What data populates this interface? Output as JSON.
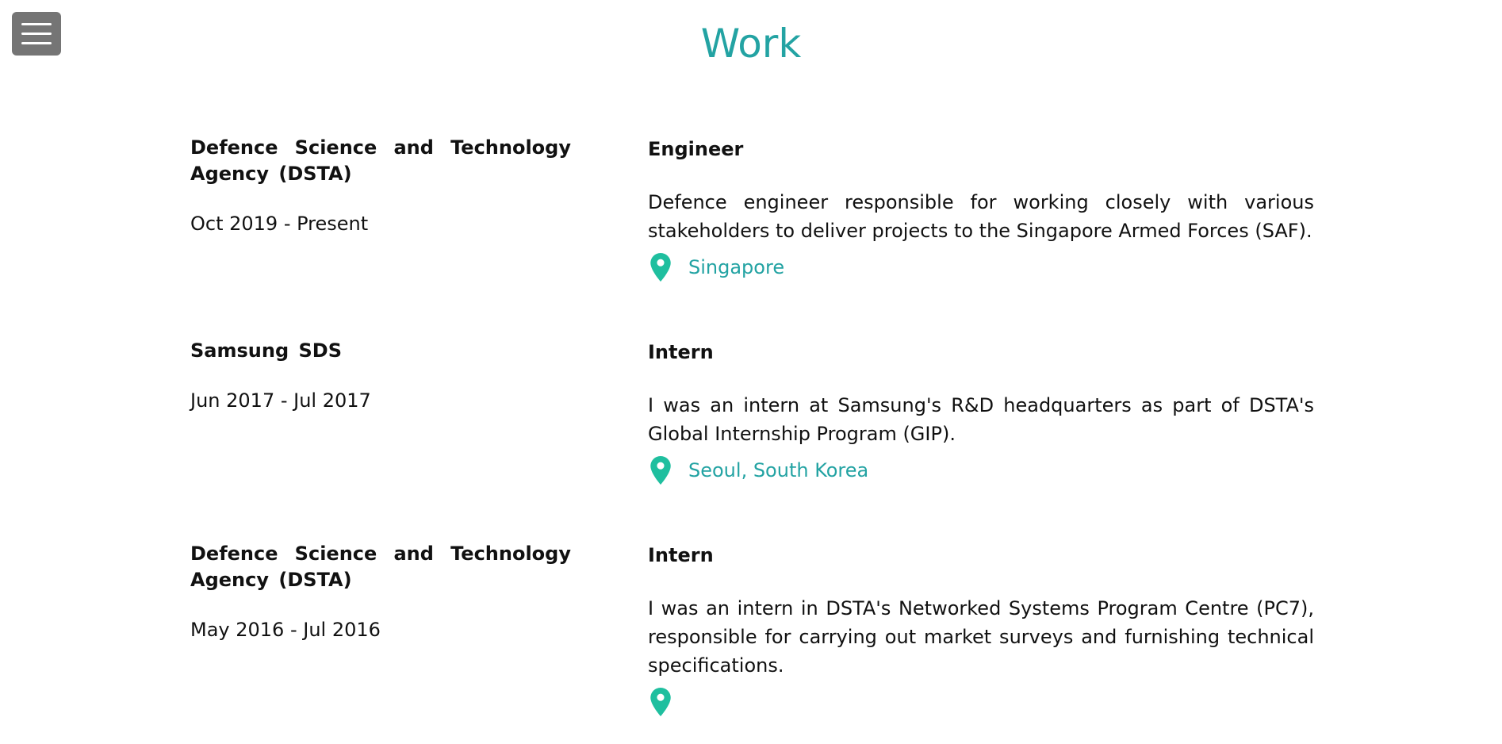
{
  "header": {
    "title": "Work"
  },
  "menu": {
    "icon": "hamburger-menu-icon"
  },
  "colors": {
    "accent": "#23a3a3",
    "pin": "#1fbf9f",
    "menu_bg": "#757575"
  },
  "entries": [
    {
      "company": "Defence Science and Technology Agency (DSTA)",
      "dates": "Oct 2019 - Present",
      "role": "Engineer",
      "description": "Defence engineer responsible for working closely with various stakeholders to deliver projects to the Singapore Armed Forces (SAF).",
      "location": "Singapore",
      "location_icon": "map-pin-icon"
    },
    {
      "company": "Samsung SDS",
      "dates": "Jun 2017 - Jul 2017",
      "role": "Intern",
      "description": "I was an intern at Samsung's R&D headquarters as part of DSTA's Global Internship Program (GIP).",
      "location": "Seoul, South Korea",
      "location_icon": "map-pin-icon"
    },
    {
      "company": "Defence Science and Technology Agency (DSTA)",
      "dates": "May 2016 - Jul 2016",
      "role": "Intern",
      "description": "I was an intern in DSTA's Networked Systems Program Centre (PC7), responsible for carrying out market surveys and furnishing technical specifications.",
      "location": "",
      "location_icon": "map-pin-icon"
    }
  ]
}
